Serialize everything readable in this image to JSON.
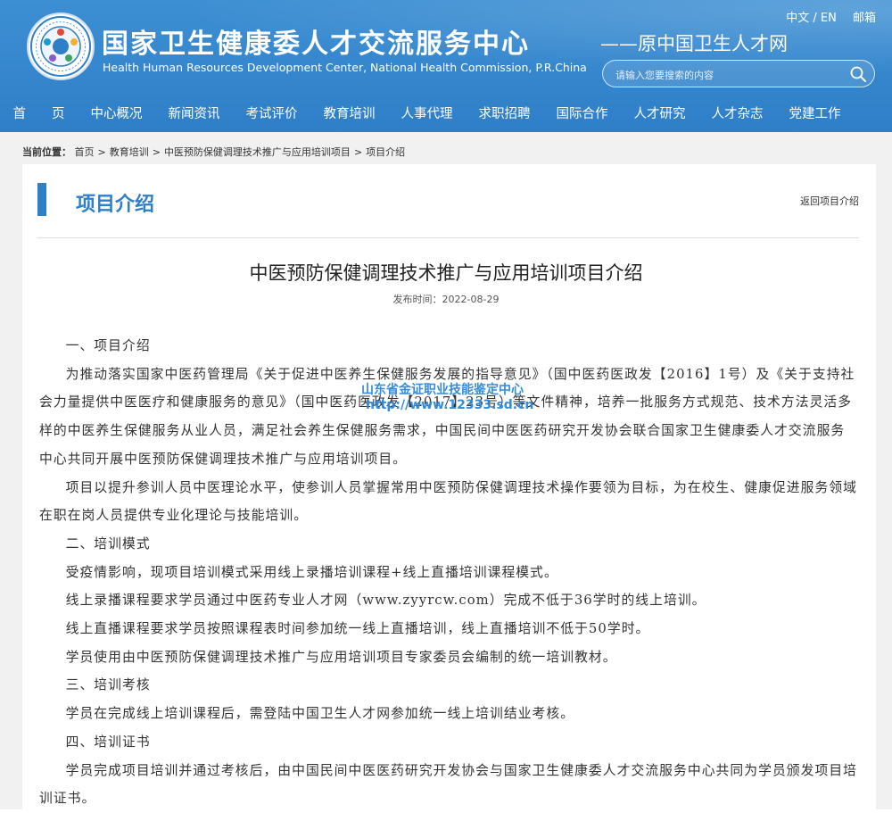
{
  "header": {
    "title_cn": "国家卫生健康委人才交流服务中心",
    "title_en": "Health Human Resources Development Center, National Health Commission, P.R.China",
    "former_name": "——原中国卫生人才网",
    "lang_switch": "中文 / EN",
    "mail": "邮箱",
    "logo_icon": "organization-logo-icon"
  },
  "search": {
    "placeholder": "请输入您要搜索的内容",
    "icon": "search-icon"
  },
  "nav": {
    "items": [
      "首　　页",
      "中心概况",
      "新闻资讯",
      "考试评价",
      "教育培训",
      "人事代理",
      "求职招聘",
      "国际合作",
      "人才研究",
      "人才杂志",
      "党建工作"
    ]
  },
  "breadcrumb": {
    "label": "当前位置：",
    "items": [
      "首页",
      "教育培训",
      "中医预防保健调理技术推广与应用培训项目",
      "项目介绍"
    ],
    "separator": ">"
  },
  "section": {
    "title": "项目介绍",
    "back_link": "返回项目介绍"
  },
  "article": {
    "title": "中医预防保健调理技术推广与应用培训项目介绍",
    "date": "发布时间：2022-08-29",
    "paragraphs": [
      "一、项目介绍",
      "为推动落实国家中医药管理局《关于促进中医养生保健服务发展的指导意见》（国中医药医政发【2016】1号）及《关于支持社会力量提供中医医疗和健康服务的意见》（国中医药医政发【2017】23号）等文件精神，培养一批服务方式规范、技术方法灵活多样的中医养生保健服务从业人员，满足社会养生保健服务需求，中国民间中医医药研究开发协会联合国家卫生健康委人才交流服务中心共同开展中医预防保健调理技术推广与应用培训项目。",
      "项目以提升参训人员中医理论水平，使参训人员掌握常用中医预防保健调理技术操作要领为目标，为在校生、健康促进服务领域在职在岗人员提供专业化理论与技能培训。",
      "二、培训模式",
      "受疫情影响，现项目培训模式采用线上录播培训课程+线上直播培训课程模式。",
      "线上录播课程要求学员通过中医药专业人才网（www.zyyrcw.com）完成不低于36学时的线上培训。",
      "线上直播课程要求学员按照课程表时间参加统一线上直播培训，线上直播培训不低于50学时。",
      "学员使用由中医预防保健调理技术推广与应用培训项目专家委员会编制的统一培训教材。",
      "三、培训考核",
      "学员在完成线上培训课程后，需登陆中国卫生人才网参加统一线上培训结业考核。",
      "四、培训证书",
      "学员完成项目培训并通过考核后，由中国民间中医医药研究开发协会与国家卫生健康委人才交流服务中心共同为学员颁发项目培训证书。"
    ]
  },
  "watermark": {
    "line1": "山东省金证职业技能鉴定中心",
    "line2": "http://www.12333.sd.cn"
  },
  "colors": {
    "brand_blue": "#2f7fc8",
    "page_bg": "#f1f1f1",
    "watermark": "#2b86d8"
  }
}
